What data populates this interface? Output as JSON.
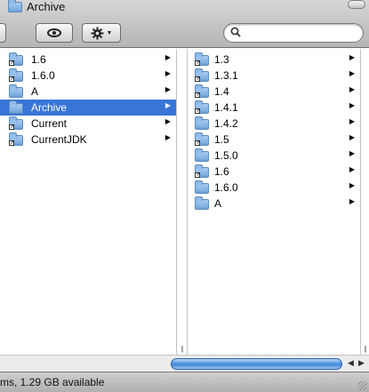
{
  "window": {
    "title": "Archive"
  },
  "toolbar": {
    "quicklook_icon": "eye-icon",
    "action_icon": "gear-icon",
    "search": {
      "value": "",
      "placeholder": ""
    }
  },
  "columns": [
    {
      "items": [
        {
          "label": "1.6",
          "alias": true,
          "selected": false
        },
        {
          "label": "1.6.0",
          "alias": true,
          "selected": false
        },
        {
          "label": "A",
          "alias": false,
          "selected": false
        },
        {
          "label": "Archive",
          "alias": false,
          "selected": true
        },
        {
          "label": "Current",
          "alias": true,
          "selected": false
        },
        {
          "label": "CurrentJDK",
          "alias": true,
          "selected": false
        }
      ]
    },
    {
      "items": [
        {
          "label": "1.3",
          "alias": true,
          "selected": false
        },
        {
          "label": "1.3.1",
          "alias": true,
          "selected": false
        },
        {
          "label": "1.4",
          "alias": true,
          "selected": false
        },
        {
          "label": "1.4.1",
          "alias": true,
          "selected": false
        },
        {
          "label": "1.4.2",
          "alias": false,
          "selected": false
        },
        {
          "label": "1.5",
          "alias": true,
          "selected": false
        },
        {
          "label": "1.5.0",
          "alias": false,
          "selected": false
        },
        {
          "label": "1.6",
          "alias": true,
          "selected": false
        },
        {
          "label": "1.6.0",
          "alias": false,
          "selected": false
        },
        {
          "label": "A",
          "alias": false,
          "selected": false
        }
      ]
    }
  ],
  "status": {
    "text": "ms, 1.29 GB available"
  },
  "colors": {
    "selection": "#3875d7",
    "folder": "#6fa3d8"
  }
}
